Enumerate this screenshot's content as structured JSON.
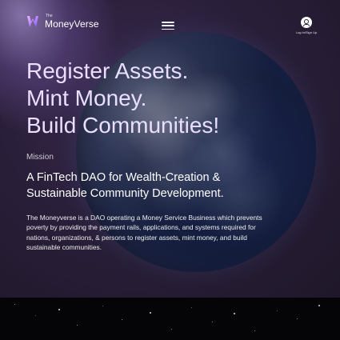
{
  "nav": {
    "brand_small": "The",
    "brand_name": "MoneyVerse",
    "menu_icon": "hamburger-menu-icon",
    "login_label": "Log In/Sign Up",
    "login_icon": "user-icon"
  },
  "hero": {
    "headline_lines": [
      "Register Assets.",
      "Mint Money.",
      "Build Communities!"
    ],
    "section_label": "Mission",
    "subheading_lines": [
      "A FinTech DAO for Wealth-Creation &",
      "Sustainable Community Development."
    ],
    "description": "The Moneyverse is a DAO operating a Money Service Business which prevents poverty by providing the payment rails, applications, and systems required for nations, organizations, & persons to register assets, mint money, and build sustainable communities."
  },
  "colors": {
    "headline": "#eadfff",
    "hero_background": "#2a1f3a",
    "starfield_background": "#050507",
    "logo_gradient_start": "#f3b5ff",
    "logo_gradient_end": "#7d5cff"
  }
}
